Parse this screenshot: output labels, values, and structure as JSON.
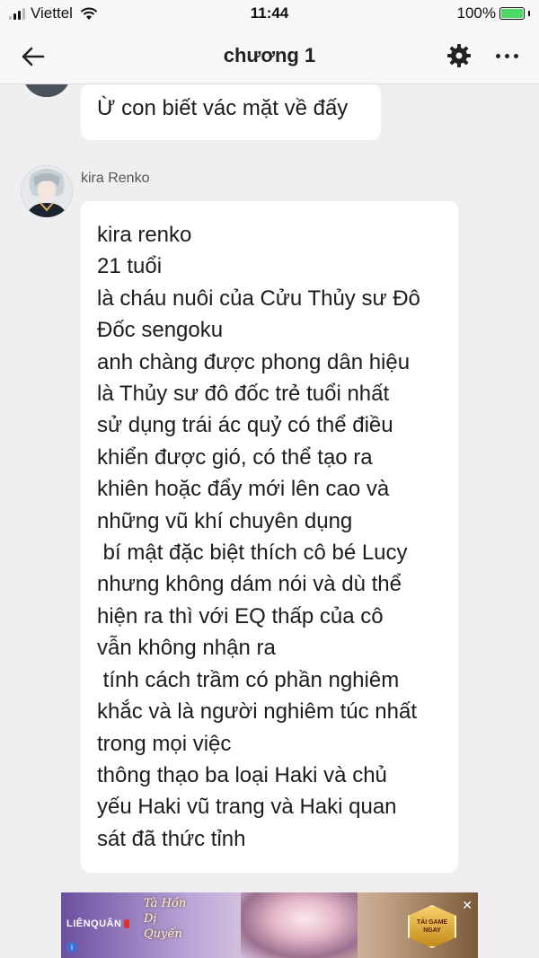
{
  "status_bar": {
    "carrier": "Viettel",
    "time": "11:44",
    "battery": "100%",
    "battery_color": "#4cd964",
    "icons": [
      "signal-icon",
      "wifi-icon",
      "battery-charging-icon"
    ]
  },
  "nav": {
    "title": "chương 1",
    "icons": [
      "back-arrow-icon",
      "gear-icon",
      "more-icon"
    ]
  },
  "messages": [
    {
      "text": "Ừ con biết vác mặt về đấy"
    },
    {
      "sender": "kira Renko",
      "lines": [
        "kira renko",
        "21 tuổi",
        "là cháu nuôi của Cửu Thủy sư Đô",
        "Đốc sengoku",
        "anh chàng được phong dân hiệu",
        "là Thủy sư đô đốc trẻ tuổi nhất",
        "sử dụng trái ác quỷ có thể điều",
        "khiển được gió, có thể tạo ra",
        "khiên hoặc đẩy mới lên cao và",
        "những vũ khí chuyên dụng",
        " bí mật đặc biệt thích cô bé Lucy",
        "nhưng không dám nói và dù thể",
        "hiện ra thì với EQ thấp của cô",
        "vẫn không nhận ra",
        " tính cách trầm có phần nghiêm",
        "khắc và là người nghiêm túc nhất",
        "trong mọi việc",
        "thông thạo ba loại Haki và chủ",
        "yếu Haki vũ trang và Haki quan",
        "sát đã thức tỉnh"
      ]
    }
  ],
  "ad": {
    "brand": "LIÊNQUÂN",
    "script_text": "Tà Hồn Dị Quyến",
    "cta": "TẢI GAME NGAY",
    "close": "✕",
    "info": "i"
  }
}
